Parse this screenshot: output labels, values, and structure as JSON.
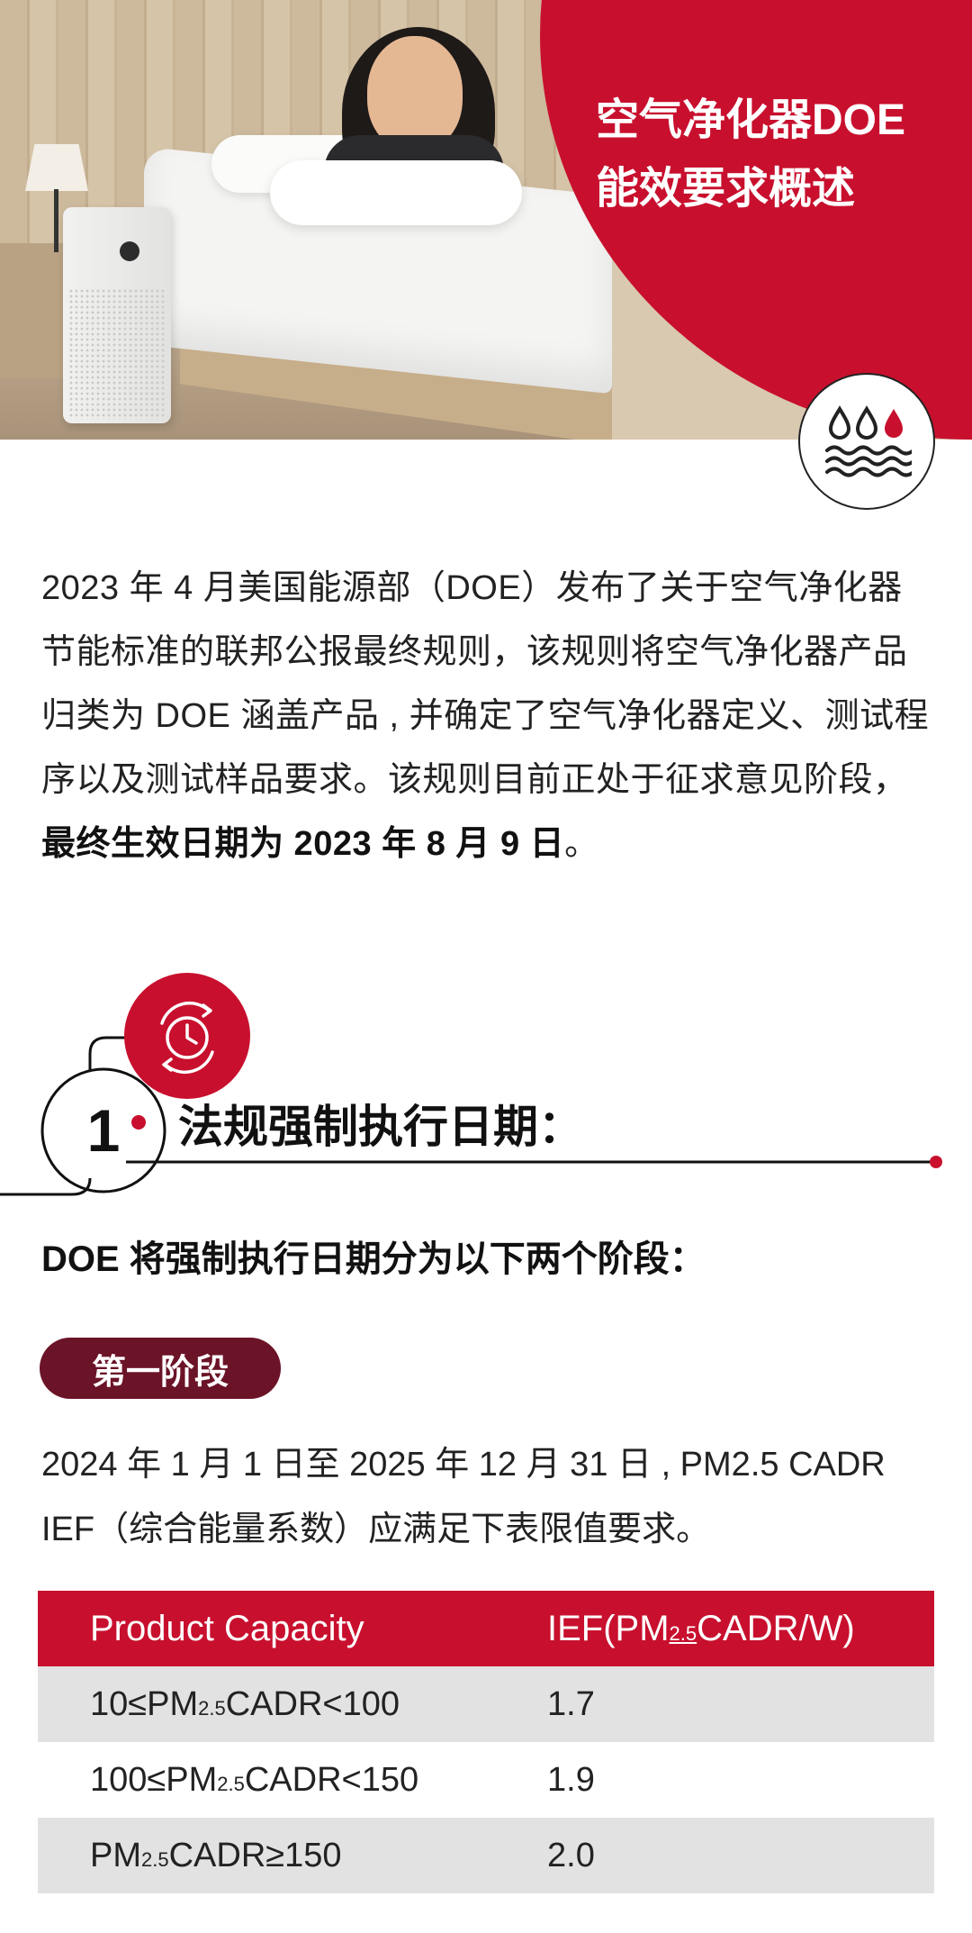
{
  "hero": {
    "title_line1": "空气净化器DOE",
    "title_line2": "能效要求概述",
    "water_badge_icon": "water-drops-waves-icon",
    "brand_red": "#c8102e"
  },
  "intro": {
    "text": "2023 年 4 月美国能源部（DOE）发布了关于空气净化器节能标准的联邦公报最终规则，该规则将空气净化器产品归类为 DOE 涵盖产品 , 并确定了空气净化器定义、测试程序以及测试样品要求。该规则目前正处于征求意见阶段，",
    "bold": "最终生效日期为 2023 年 8 月 9 日",
    "end": "。"
  },
  "section1": {
    "icon": "clock-cycle-icon",
    "number": "1",
    "title": "法规强制执行日期："
  },
  "lead": "DOE 将强制执行日期分为以下两个阶段：",
  "phase1": {
    "label": "第一阶段",
    "color": "#6b1327",
    "text_line1": "2024 年 1 月 1 日至 2025 年 12 月 31 日 , PM2.5 CADR",
    "text_line2": "IEF（综合能量系数）应满足下表限值要求。"
  },
  "table": {
    "header_col1": "Product Capacity",
    "header_col2_a": "IEF(PM",
    "header_col2_sub": "2.5",
    "header_col2_b": "CADR/W)",
    "rows": [
      {
        "pre": "10≤PM",
        "sub": "2.5",
        "post": "CADR<100",
        "value": "1.7"
      },
      {
        "pre": "100≤PM",
        "sub": "2.5",
        "post": "CADR<150",
        "value": "1.9"
      },
      {
        "pre": "PM",
        "sub": "2.5",
        "post": "CADR≥150",
        "value": "2.0"
      }
    ]
  }
}
